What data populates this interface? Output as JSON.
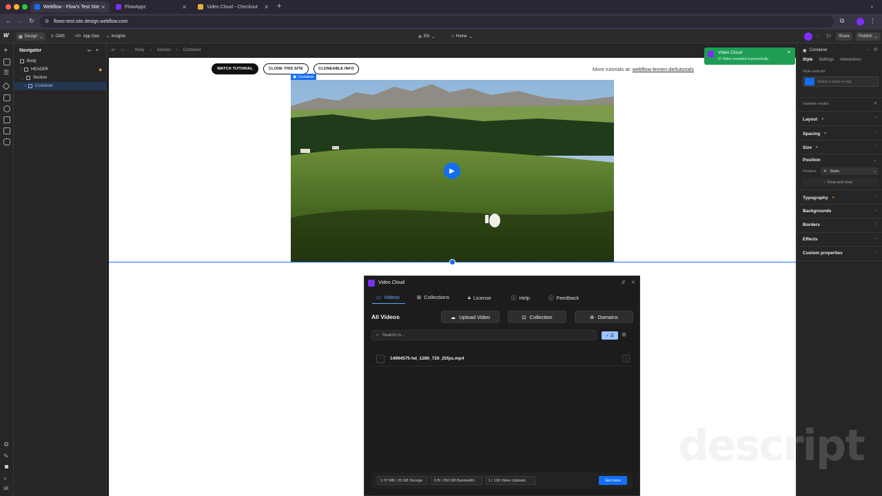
{
  "browser": {
    "tabs": [
      {
        "label": "Webflow - Flow's Test Site",
        "active": true
      },
      {
        "label": "FlowAppz",
        "active": false
      },
      {
        "label": "Video Cloud - Checkout",
        "active": false
      }
    ],
    "url": "flows-test-site.design.webflow.com"
  },
  "topbar": {
    "mode": "Design",
    "cms": "CMS",
    "app_gen": "App Gen",
    "insights": "Insights",
    "locale": "EN",
    "page": "Home",
    "share": "Share",
    "publish": "Publish"
  },
  "navigator": {
    "title": "Navigator",
    "items": [
      "Body",
      "HEADER",
      "Section",
      "Container"
    ]
  },
  "breadcrumb": [
    "Body",
    "Section",
    "Container"
  ],
  "canvas": {
    "btn_watch": "WATCH TUTORIAL",
    "btn_clone": "CLONE THIS SITE",
    "btn_info": "CLONEABLE INFO",
    "more_text": "More tutorials at:",
    "more_link": "webflow-lernen.de/tutorials",
    "selection_label": "Container"
  },
  "toast": {
    "title": "Video Cloud",
    "message": "Video inserted successfully."
  },
  "right_panel": {
    "element": "Container",
    "tabs": [
      "Style",
      "Settings",
      "Interactions"
    ],
    "style_selector_label": "Style selector",
    "selector_placeholder": "Select a class or tag",
    "variable_modes": "Variable modes",
    "sections": [
      "Layout",
      "Spacing",
      "Size",
      "Position",
      "Typography",
      "Backgrounds",
      "Borders",
      "Effects",
      "Custom properties"
    ],
    "position_label": "Position",
    "position_value": "Static",
    "float_clear": "Float and clear"
  },
  "modal": {
    "title": "Video Cloud",
    "tabs": [
      "Videos",
      "Collections",
      "License",
      "Help",
      "Feedback"
    ],
    "heading": "All Videos",
    "upload": "Upload Video",
    "collection": "Collection",
    "domains": "Domains",
    "search_placeholder": "Search in...",
    "files": [
      "14994575-hd_1280_720_25fps.mp4"
    ],
    "stats": [
      "1.07 MB / 25 GB Storage",
      "0 B / 250 GB Bandwidth",
      "1 / 100 Video Uploads"
    ],
    "get_more": "Get more"
  },
  "watermark": "descript",
  "colors": {
    "accent_blue": "#146ef5",
    "toast_green": "#1f9d55",
    "brand_purple": "#7b2ff7"
  }
}
